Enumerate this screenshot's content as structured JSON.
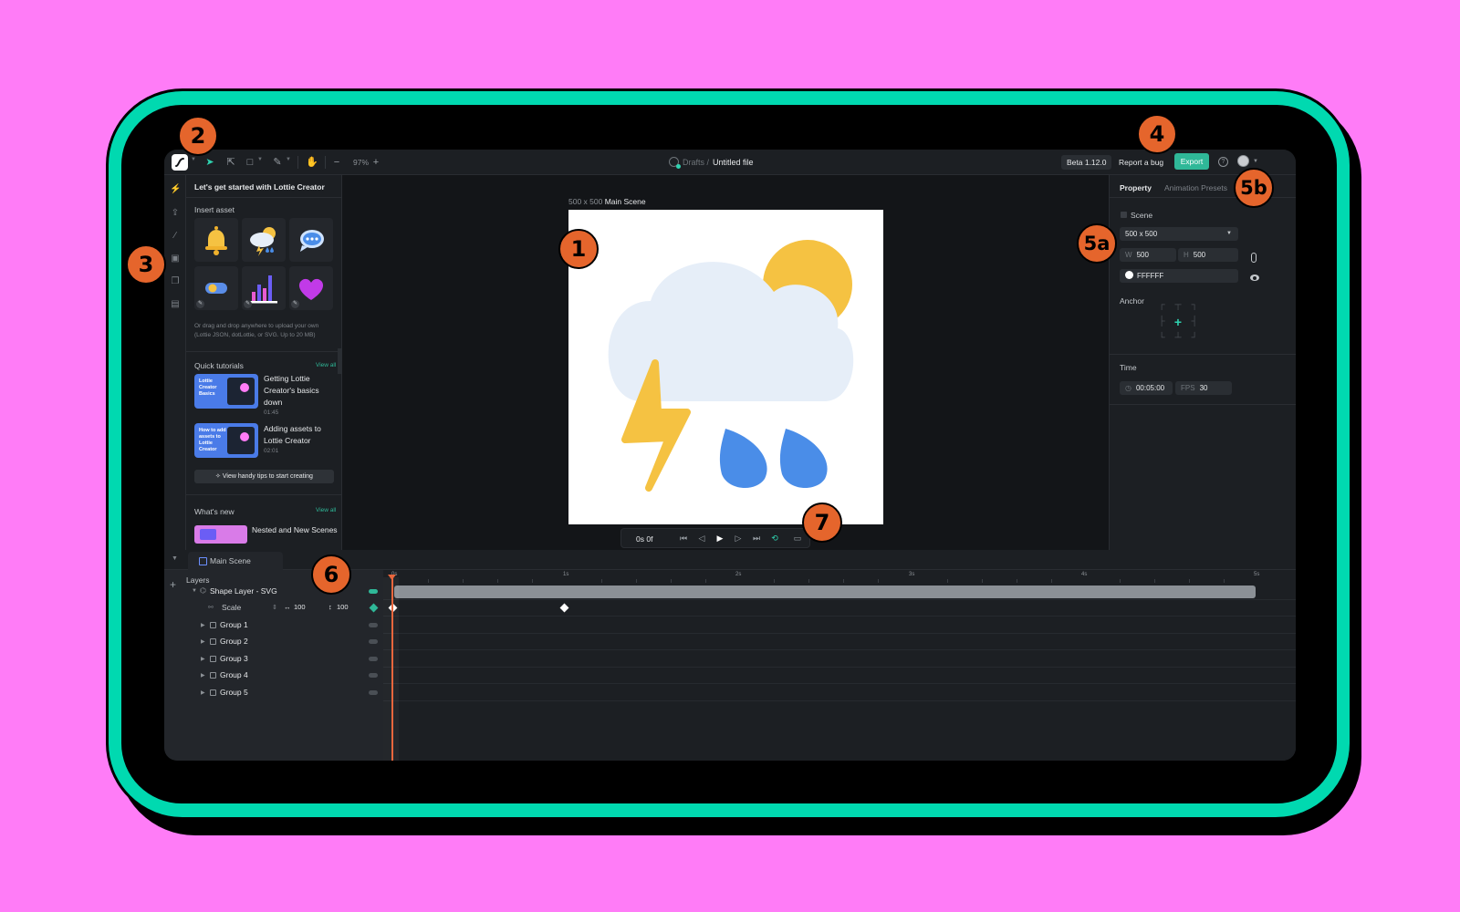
{
  "topbar": {
    "zoom": "97%",
    "breadcrumb_drafts": "Drafts /",
    "file_name": "Untitled file",
    "version": "Beta 1.12.0",
    "report_bug": "Report a bug",
    "export": "Export",
    "help_glyph": "?"
  },
  "left_panel": {
    "title": "Let's get started with Lottie Creator",
    "insert_asset": "Insert asset",
    "upload_hint": "Or drag and drop anywhere to upload your own (Lottie JSON, dotLottie, or SVG. Up to 20 MB)",
    "quick_tutorials": "Quick tutorials",
    "view_all": "View all",
    "tutorials": [
      {
        "title": "Getting Lottie Creator's basics down",
        "duration": "01:45",
        "thumb": "Lottie Creator Basics"
      },
      {
        "title": "Adding assets to Lottie Creator",
        "duration": "02:01",
        "thumb": "How to add assets to Lottie Creator"
      }
    ],
    "tips_button": "View handy tips to start creating",
    "whats_new": "What's new",
    "whats_new_view_all": "View all",
    "news_item": "Nested and New Scenes"
  },
  "canvas": {
    "scene_size": "500 x 500",
    "scene_name": "Main Scene",
    "time": "0s 0f"
  },
  "right_panel": {
    "tab_property": "Property",
    "tab_presets": "Animation Presets",
    "scene_label": "Scene",
    "size_preset": "500 x 500",
    "width_label": "W",
    "width": "500",
    "height_label": "H",
    "height": "500",
    "bg_color": "FFFFFF",
    "anchor_label": "Anchor",
    "time_label": "Time",
    "duration": "00:05:00",
    "fps_label": "FPS",
    "fps": "30"
  },
  "timeline": {
    "tab": "Main Scene",
    "layers_label": "Layers",
    "add_glyph": "+",
    "shape_layer": "Shape Layer - SVG",
    "scale_label": "Scale",
    "scale_x": "100",
    "scale_y": "100",
    "groups": [
      "Group 1",
      "Group 2",
      "Group 3",
      "Group 4",
      "Group 5"
    ],
    "ticks": [
      "0s",
      "1s",
      "2s",
      "3s",
      "4s",
      "5s"
    ]
  },
  "markers": [
    "1",
    "2",
    "3",
    "4",
    "5a",
    "5b",
    "6",
    "7"
  ],
  "colors": {
    "accent": "#2fb898",
    "frame": "#00d9b0",
    "background": "#ff7cf7",
    "marker": "#e5652c",
    "playhead": "#e8663d"
  },
  "icons": [
    "lottie-logo-icon",
    "select-arrow-icon",
    "direct-select-icon",
    "rectangle-tool-icon",
    "pen-tool-icon",
    "hand-icon",
    "zoom-out-icon",
    "zoom-in-icon",
    "cloud-saved-icon",
    "help-icon",
    "avatar",
    "bolt-icon",
    "upload-icon",
    "draw-icon",
    "library-icon",
    "layers-icon",
    "template-icon"
  ]
}
